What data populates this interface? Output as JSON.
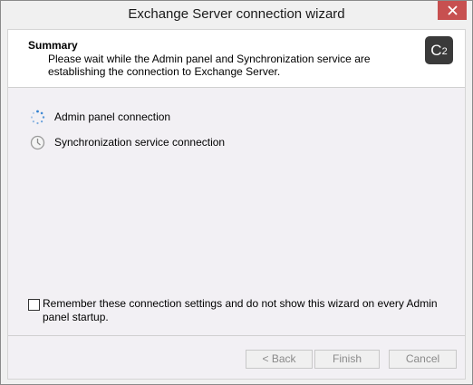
{
  "window": {
    "title": "Exchange Server connection wizard"
  },
  "header": {
    "title": "Summary",
    "description": "Please wait while the Admin panel and Synchronization service are establishing the connection to Exchange Server.",
    "logo_text": "C",
    "logo_sup": "2"
  },
  "steps": [
    {
      "label": "Admin panel connection",
      "icon": "loading-spinner-icon",
      "status": "in-progress"
    },
    {
      "label": "Synchronization service connection",
      "icon": "clock-icon",
      "status": "pending"
    }
  ],
  "remember": {
    "label": "Remember these connection settings and do not show this wizard on every Admin panel startup.",
    "checked": false
  },
  "buttons": {
    "back": "< Back",
    "finish": "Finish",
    "cancel": "Cancel"
  },
  "colors": {
    "close_button": "#c75050",
    "spinner": "#2f7fd0",
    "disabled_text": "#8a8a8a"
  }
}
